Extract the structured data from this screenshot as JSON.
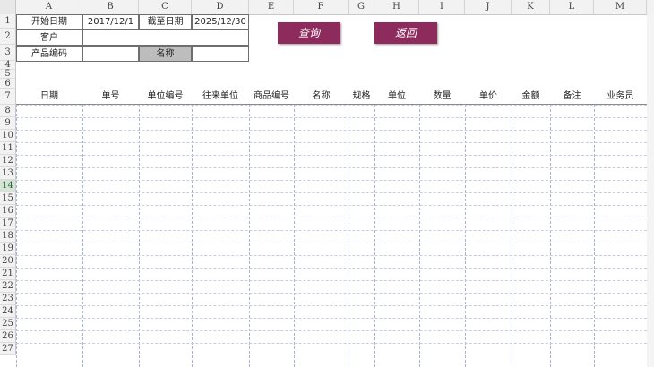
{
  "columns": [
    "A",
    "B",
    "C",
    "D",
    "E",
    "F",
    "G",
    "H",
    "I",
    "J",
    "K",
    "L",
    "M"
  ],
  "rows": [
    "1",
    "2",
    "3",
    "4",
    "5",
    "6",
    "7",
    "8",
    "9",
    "10",
    "11",
    "12",
    "13",
    "14",
    "15",
    "16",
    "17",
    "18",
    "19",
    "20",
    "21",
    "22",
    "23",
    "24",
    "25",
    "26",
    "27"
  ],
  "selected_row": "14",
  "params": {
    "start_label": "开始日期",
    "start_value": "2017/12/1",
    "end_label": "截至日期",
    "end_value": "2025/12/30",
    "customer_label": "客户",
    "customer_value": "",
    "product_code_label": "产品编码",
    "product_code_value": "",
    "name_label": "名称",
    "name_value": ""
  },
  "buttons": {
    "query": "查询",
    "back": "返回"
  },
  "table_headers": [
    "日期",
    "单号",
    "单位编号",
    "往来单位",
    "商品编号",
    "名称",
    "规格",
    "单位",
    "数量",
    "单价",
    "金额",
    "备注",
    "业务员"
  ],
  "colors": {
    "button_bg": "#8c2b5c",
    "grid_dash": "#a9afe0",
    "selected_row_header": "#d6e3d6"
  }
}
